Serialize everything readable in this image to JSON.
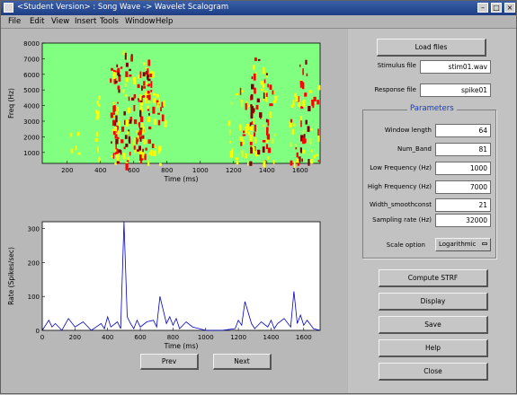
{
  "window": {
    "title": "<Student Version> : Song Wave -> Wavelet Scalogram",
    "controls": {
      "minimize": "–",
      "maximize": "□",
      "close": "×"
    }
  },
  "menu": [
    "File",
    "Edit",
    "View",
    "Insert",
    "Tools",
    "Window",
    "Help"
  ],
  "spectrogram": {
    "ylabel": "Freq (Hz)",
    "xlabel": "Time (ms)",
    "yticks": [
      "1000",
      "2000",
      "3000",
      "4000",
      "5000",
      "6000",
      "7000",
      "8000"
    ],
    "xticks": [
      "200",
      "400",
      "600",
      "800",
      "1000",
      "1200",
      "1400",
      "1600"
    ],
    "colors": {
      "background": "#80ff80",
      "low": "#ffff00",
      "mid": "#ff0000",
      "high": "#7f0000"
    }
  },
  "chart_data": [
    {
      "type": "heatmap",
      "title": "",
      "xlabel": "Time (ms)",
      "ylabel": "Freq (Hz)",
      "xlim": [
        50,
        1720
      ],
      "ylim": [
        300,
        8000
      ],
      "x": [
        240,
        390,
        480,
        500,
        560,
        620,
        640,
        660,
        700,
        760,
        1190,
        1260,
        1320,
        1380,
        1420,
        1560,
        1620,
        1680
      ],
      "intensity_by_time": [
        1,
        2,
        5,
        6,
        7,
        4,
        5,
        6,
        5,
        3,
        2,
        4,
        7,
        5,
        3,
        4,
        6,
        3
      ]
    },
    {
      "type": "line",
      "title": "",
      "xlabel": "Time (ms)",
      "ylabel": "Rate (Spikes/sec)",
      "xlim": [
        0,
        1700
      ],
      "ylim": [
        0,
        320
      ],
      "xticks": [
        0,
        200,
        400,
        600,
        800,
        1000,
        1200,
        1400,
        1600
      ],
      "yticks": [
        0,
        100,
        200,
        300
      ],
      "series": [
        {
          "color": "#0000cc",
          "x": [
            0,
            40,
            60,
            80,
            120,
            160,
            200,
            250,
            300,
            360,
            380,
            400,
            420,
            460,
            480,
            500,
            520,
            540,
            560,
            580,
            600,
            640,
            680,
            700,
            720,
            760,
            780,
            800,
            820,
            840,
            880,
            920,
            1000,
            1100,
            1180,
            1200,
            1220,
            1240,
            1280,
            1300,
            1340,
            1380,
            1400,
            1420,
            1440,
            1480,
            1520,
            1540,
            1560,
            1580,
            1600,
            1620,
            1660,
            1700
          ],
          "y": [
            0,
            30,
            10,
            20,
            0,
            35,
            10,
            25,
            0,
            20,
            5,
            40,
            10,
            25,
            5,
            320,
            40,
            20,
            5,
            30,
            10,
            25,
            30,
            10,
            100,
            20,
            40,
            15,
            35,
            5,
            25,
            10,
            0,
            0,
            5,
            30,
            15,
            85,
            20,
            5,
            25,
            10,
            30,
            5,
            20,
            35,
            10,
            115,
            20,
            45,
            15,
            30,
            5,
            0
          ]
        }
      ]
    }
  ],
  "ratePlot": {
    "ylabel": "Rate (Spikes/sec)",
    "xlabel": "Time (ms)",
    "yticks": [
      "0",
      "100",
      "200",
      "300"
    ],
    "xticks": [
      "0",
      "200",
      "400",
      "600",
      "800",
      "1000",
      "1200",
      "1400",
      "1600"
    ],
    "line_color": "#0000cc"
  },
  "nav": {
    "prev": "Prev",
    "next": "Next"
  },
  "panel": {
    "load_files": "Load files",
    "stimulus_label": "Stimulus file",
    "stimulus_value": "stim01.wav",
    "response_label": "Response file",
    "response_value": "spike01",
    "params_title": "Parameters",
    "params": [
      {
        "label": "Window length",
        "value": "64"
      },
      {
        "label": "Num_Band",
        "value": "81"
      },
      {
        "label": "Low Frequency (Hz)",
        "value": "1000"
      },
      {
        "label": "High Frequency (Hz)",
        "value": "7000"
      },
      {
        "label": "Width_smoothconst",
        "value": "21"
      },
      {
        "label": "Sampling rate (Hz)",
        "value": "32000"
      }
    ],
    "scale_label": "Scale option",
    "scale_value": "Logarithmic",
    "buttons": [
      "Compute STRF",
      "Display",
      "Save",
      "Help",
      "Close"
    ]
  }
}
